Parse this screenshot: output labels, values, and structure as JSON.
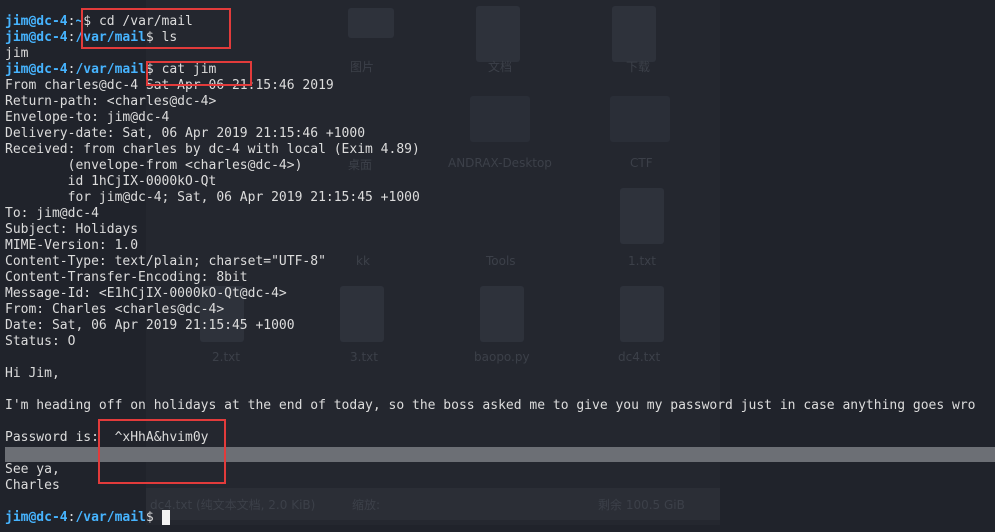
{
  "desktop": {
    "labels": [
      "图片",
      "文档",
      "下载",
      "桌面",
      "ANDRAX-Desktop",
      "CTF",
      "kk",
      "Tools",
      "1.txt",
      "2.txt",
      "3.txt",
      "baopo.py",
      "dc4.txt"
    ],
    "status_bar": {
      "file_info": "dc4.txt (纯文本文档, 2.0 KiB)",
      "zoom_label": "缩放:",
      "free_space": "剩余 100.5 GiB"
    }
  },
  "terminal": {
    "prompt_user": "jim@dc-4",
    "cmd1": {
      "path": "~",
      "text": "cd /var/mail"
    },
    "cmd2": {
      "path": "/var/mail",
      "text": "ls"
    },
    "ls_output": "jim",
    "cmd3": {
      "path": "/var/mail",
      "text": "cat jim"
    },
    "mail_lines": [
      "From charles@dc-4 Sat Apr 06 21:15:46 2019",
      "Return-path: <charles@dc-4>",
      "Envelope-to: jim@dc-4",
      "Delivery-date: Sat, 06 Apr 2019 21:15:46 +1000",
      "Received: from charles by dc-4 with local (Exim 4.89)",
      "        (envelope-from <charles@dc-4>)",
      "        id 1hCjIX-0000kO-Qt",
      "        for jim@dc-4; Sat, 06 Apr 2019 21:15:45 +1000",
      "To: jim@dc-4",
      "Subject: Holidays",
      "MIME-Version: 1.0",
      "Content-Type: text/plain; charset=\"UTF-8\"",
      "Content-Transfer-Encoding: 8bit",
      "Message-Id: <E1hCjIX-0000kO-Qt@dc-4>",
      "From: Charles <charles@dc-4>",
      "Date: Sat, 06 Apr 2019 21:15:45 +1000",
      "Status: O"
    ],
    "body_greeting": "Hi Jim,",
    "body_text": "I'm heading off on holidays at the end of today, so the boss asked me to give you my password just in case anything goes wro",
    "password_line": "Password is:  ^xHhA&hvim0y",
    "signoff1": "See ya,",
    "signoff2": "Charles",
    "cmd4": {
      "path": "/var/mail",
      "text": ""
    }
  },
  "colors": {
    "prompt": "#46b4ff",
    "text": "#dcdcdc",
    "highlight": "#e23b3b"
  }
}
